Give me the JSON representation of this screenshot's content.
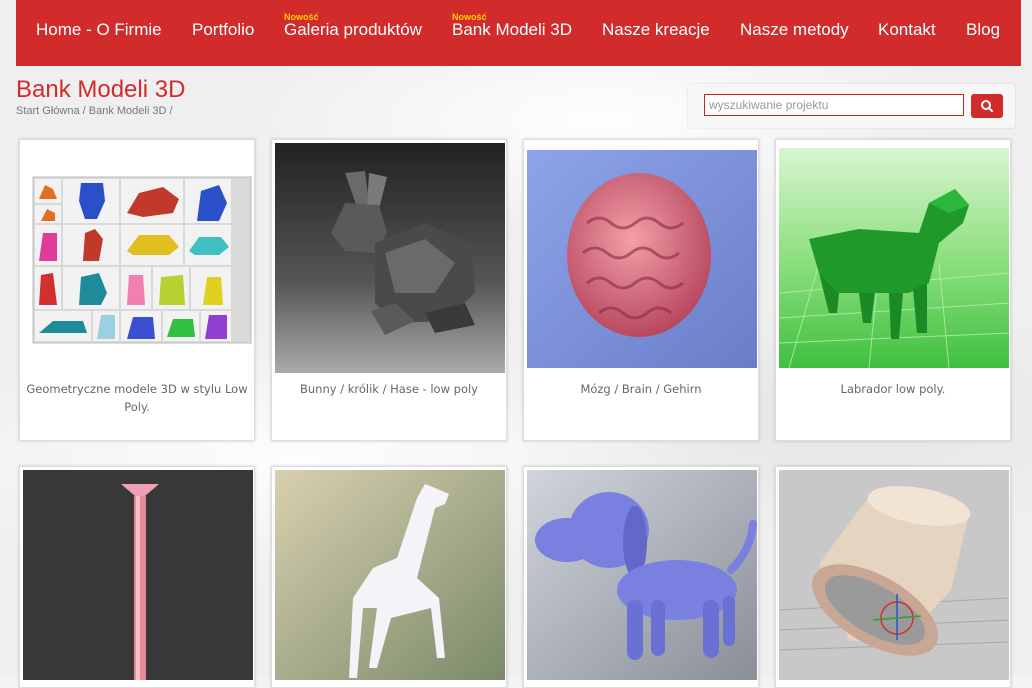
{
  "nav": {
    "items": [
      {
        "label": "Home - O Firmie"
      },
      {
        "label": "Portfolio"
      },
      {
        "label": "Galeria produktów",
        "badge": "Nowość"
      },
      {
        "label": "Bank Modeli 3D",
        "badge": "Nowość"
      },
      {
        "label": "Nasze kreacje"
      },
      {
        "label": "Nasze metody"
      },
      {
        "label": "Kontakt"
      },
      {
        "label": "Blog"
      }
    ]
  },
  "page": {
    "title": "Bank Modeli 3D",
    "breadcrumb": [
      "Start Główna",
      "Bank Modeli 3D"
    ],
    "breadcrumb_sep": " / "
  },
  "search": {
    "placeholder": "wyszukiwanie projektu",
    "icon": "search-icon"
  },
  "gallery": {
    "items": [
      {
        "caption": "Geometryczne modele 3D w stylu Low Poly.",
        "image": "low-poly-models-collage"
      },
      {
        "caption": "Bunny / królik / Hase - low poly",
        "image": "low-poly-bunny"
      },
      {
        "caption": "Mózg / Brain / Gehirn",
        "image": "brain-model"
      },
      {
        "caption": "Labrador low poly.",
        "image": "low-poly-labrador"
      },
      {
        "caption": "",
        "image": "pink-stick-model"
      },
      {
        "caption": "",
        "image": "giraffe-model"
      },
      {
        "caption": "",
        "image": "cartoon-dog-model"
      },
      {
        "caption": "",
        "image": "cylinder-cap-model"
      }
    ]
  },
  "colors": {
    "brand_red": "#d22b2b",
    "badge_yellow": "#ffd200"
  }
}
